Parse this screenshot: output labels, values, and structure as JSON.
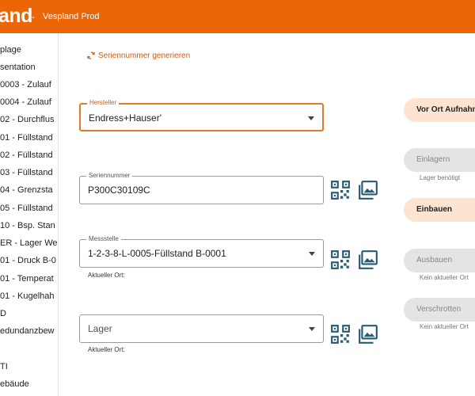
{
  "appbar": {
    "logo_text": "and",
    "separator": "-",
    "title": "Vespland Prod"
  },
  "colors": {
    "brand": "#ec6608",
    "accent_text": "#d45a0a",
    "active_button_bg": "#fde4d1",
    "disabled_button_bg": "#e4e4e4"
  },
  "sidebar": {
    "items": [
      "plage",
      "sentation",
      "0003 - Zulauf",
      "0004 - Zulauf",
      "02 - Durchflus",
      "01 - Füllstand",
      "02 - Füllstand",
      "03 - Füllstand",
      "04 - Grenzsta",
      "05 - Füllstand",
      "10 - Bsp. Stan",
      "ER - Lager We",
      "01 - Druck B-0",
      "01 - Temperat",
      "01 - Kugelhah",
      "D",
      "edundanzbew",
      "",
      "TI",
      "ebäude"
    ]
  },
  "main": {
    "generate_link": "Seriennummer generieren",
    "hersteller": {
      "label": "Hersteller",
      "value": "Endress+Hauser'"
    },
    "seriennummer": {
      "label": "Seriennummer",
      "value": "P300C30109C"
    },
    "messstelle": {
      "label": "Messstelle",
      "value": "1-2-3-8-L-0005-Füllstand B-0001",
      "helper": "Aktueller Ort:"
    },
    "lager": {
      "placeholder": "Lager",
      "helper": "Aktueller Ort:"
    }
  },
  "actions": {
    "vor_ort": "Vor Ort Aufnahme",
    "einlagern": "Einlagern",
    "einlagern_note": "Lager benötigt",
    "einbauen": "Einbauen",
    "ausbauen": "Ausbauen",
    "ausbauen_note": "Kein aktueller Ort",
    "verschrotten": "Verschrotten",
    "verschrotten_note": "Kein aktueller Ort"
  }
}
